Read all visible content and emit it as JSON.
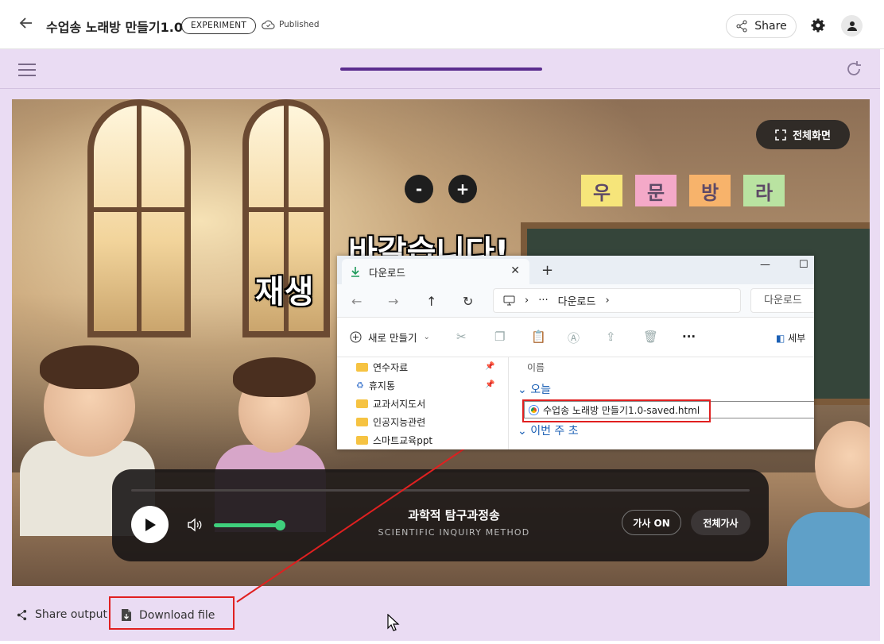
{
  "header": {
    "title": "수업송 노래방 만들기1.0",
    "badge": "EXPERIMENT",
    "status": "Published",
    "share_label": "Share"
  },
  "stage": {
    "fullscreen_label": "전체화면",
    "zoom_out": "-",
    "zoom_in": "+",
    "lyric_line1": "바갈습니다!",
    "lyric_line2": "재생",
    "word_cards": [
      "우",
      "문",
      "방",
      "라"
    ],
    "word_card_colors": [
      "#f6e57a",
      "#f4a9c8",
      "#f7b36b",
      "#b9e3a1"
    ]
  },
  "player": {
    "song_title": "과학적 탐구과정송",
    "song_subtitle": "SCIENTIFIC INQUIRY METHOD",
    "lyrics_button": "가사 ON",
    "full_lyrics_button": "전체가사",
    "volume_level": 1.0,
    "accent": "#3fd07c"
  },
  "actions": {
    "share_output": "Share output",
    "download_file": "Download file"
  },
  "explorer": {
    "tab_title": "다운로드",
    "address_more": "···",
    "address_folder": "다운로드",
    "search_placeholder": "다운로드",
    "new_button": "새로 만들기",
    "more": "···",
    "details": "세부",
    "sidebar": [
      {
        "label": "연수자료",
        "pinned": true
      },
      {
        "label": "휴지통",
        "pinned": true
      },
      {
        "label": "교과서지도서",
        "pinned": false
      },
      {
        "label": "인공지능관련",
        "pinned": false
      },
      {
        "label": "스마트교육ppt",
        "pinned": false
      }
    ],
    "column_name": "이름",
    "group_today": "오늘",
    "group_this_week": "이번 주 초",
    "file_name": "수업송 노래방 만들기1.0-saved.html"
  },
  "colors": {
    "lavender": "#eadcf3",
    "progress": "#5b2d8e",
    "annotation_red": "#e02020",
    "folder": "#f6c342"
  }
}
